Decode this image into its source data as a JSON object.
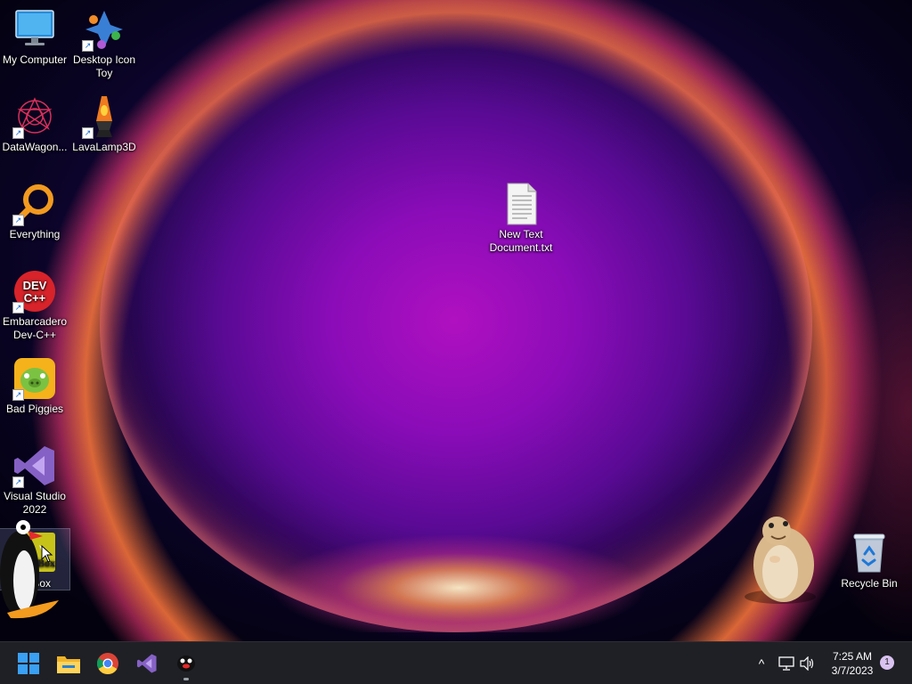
{
  "desktop": {
    "icons": [
      {
        "label": "My Computer",
        "icon": "monitor-icon"
      },
      {
        "label": "Desktop Icon Toy",
        "icon": "desktop-icon-toy-icon"
      },
      {
        "label": "DataWagon...",
        "icon": "datawagon-icon"
      },
      {
        "label": "LavaLamp3D",
        "icon": "lava-lamp-icon"
      },
      {
        "label": "Everything",
        "icon": "magnifier-icon"
      },
      {
        "label": "Embarcadero Dev-C++",
        "icon": "dev-cpp-icon",
        "badge_text": "DEV C++"
      },
      {
        "label": "Bad Piggies",
        "icon": "bad-piggies-icon"
      },
      {
        "label": "Visual Studio 2022",
        "icon": "visual-studio-icon"
      },
      {
        "label": "nikBox",
        "icon": "box-icon",
        "badge_text": "Box"
      },
      {
        "label": "New Text Document.txt",
        "icon": "text-document-icon"
      },
      {
        "label": "Recycle Bin",
        "icon": "recycle-bin-icon"
      }
    ],
    "overlays": [
      {
        "name": "penguin-mascot",
        "icon": "penguin-icon"
      },
      {
        "name": "hamster-mascot",
        "icon": "hamster-icon"
      }
    ]
  },
  "taskbar": {
    "apps": [
      {
        "name": "start",
        "icon": "windows-start-icon"
      },
      {
        "name": "file-explorer",
        "icon": "folder-icon"
      },
      {
        "name": "chrome",
        "icon": "chrome-icon"
      },
      {
        "name": "visual-studio",
        "icon": "visual-studio-icon"
      },
      {
        "name": "penguin-app",
        "icon": "penguin-icon"
      }
    ],
    "tray": {
      "chevron": "^",
      "icons": [
        "show-hidden-icon",
        "network-icon",
        "volume-icon"
      ]
    },
    "clock": {
      "time": "7:25 AM",
      "date": "3/7/2023"
    },
    "notification_count": "1"
  },
  "colors": {
    "taskbar": "#1f2026",
    "accent": "#b010c0"
  }
}
